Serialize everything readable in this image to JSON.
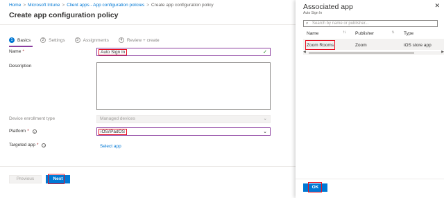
{
  "breadcrumb": [
    {
      "label": "Home"
    },
    {
      "label": "Microsoft Intune"
    },
    {
      "label": "Client apps - App configuration policies"
    },
    {
      "label": "Create app configuration policy"
    }
  ],
  "page_title": "Create app configuration policy",
  "wizard_steps": [
    {
      "num": "1",
      "label": "Basics"
    },
    {
      "num": "2",
      "label": "Settings"
    },
    {
      "num": "3",
      "label": "Assignments"
    },
    {
      "num": "4",
      "label": "Review + create"
    }
  ],
  "form": {
    "name_label": "Name",
    "name_value": "Auto Sign In",
    "description_label": "Description",
    "description_value": "",
    "enrollment_label": "Device enrollment type",
    "enrollment_value": "Managed devices",
    "platform_label": "Platform",
    "platform_value": "iOS/iPadOS",
    "targeted_app_label": "Targeted app",
    "select_app_link": "Select app",
    "required_mark": "*"
  },
  "footer": {
    "previous_label": "Previous",
    "next_label": "Next"
  },
  "blade": {
    "title": "Associated app",
    "subtitle": "Auto Sign In",
    "search_placeholder": "Search by name or publisher...",
    "columns": [
      "Name",
      "Publisher",
      "Type"
    ],
    "rows": [
      {
        "name": "Zoom Rooms",
        "publisher": "Zoom",
        "type": "iOS store app"
      }
    ],
    "ok_label": "OK"
  },
  "icons": {
    "check": "✓",
    "chevron_down": "⌄",
    "close": "✕",
    "search": "⌕",
    "sort": "↑↓",
    "info": "i"
  },
  "colors": {
    "accent": "#0078d4",
    "highlight": "#e81123",
    "focus_border": "#8a3c9f"
  }
}
